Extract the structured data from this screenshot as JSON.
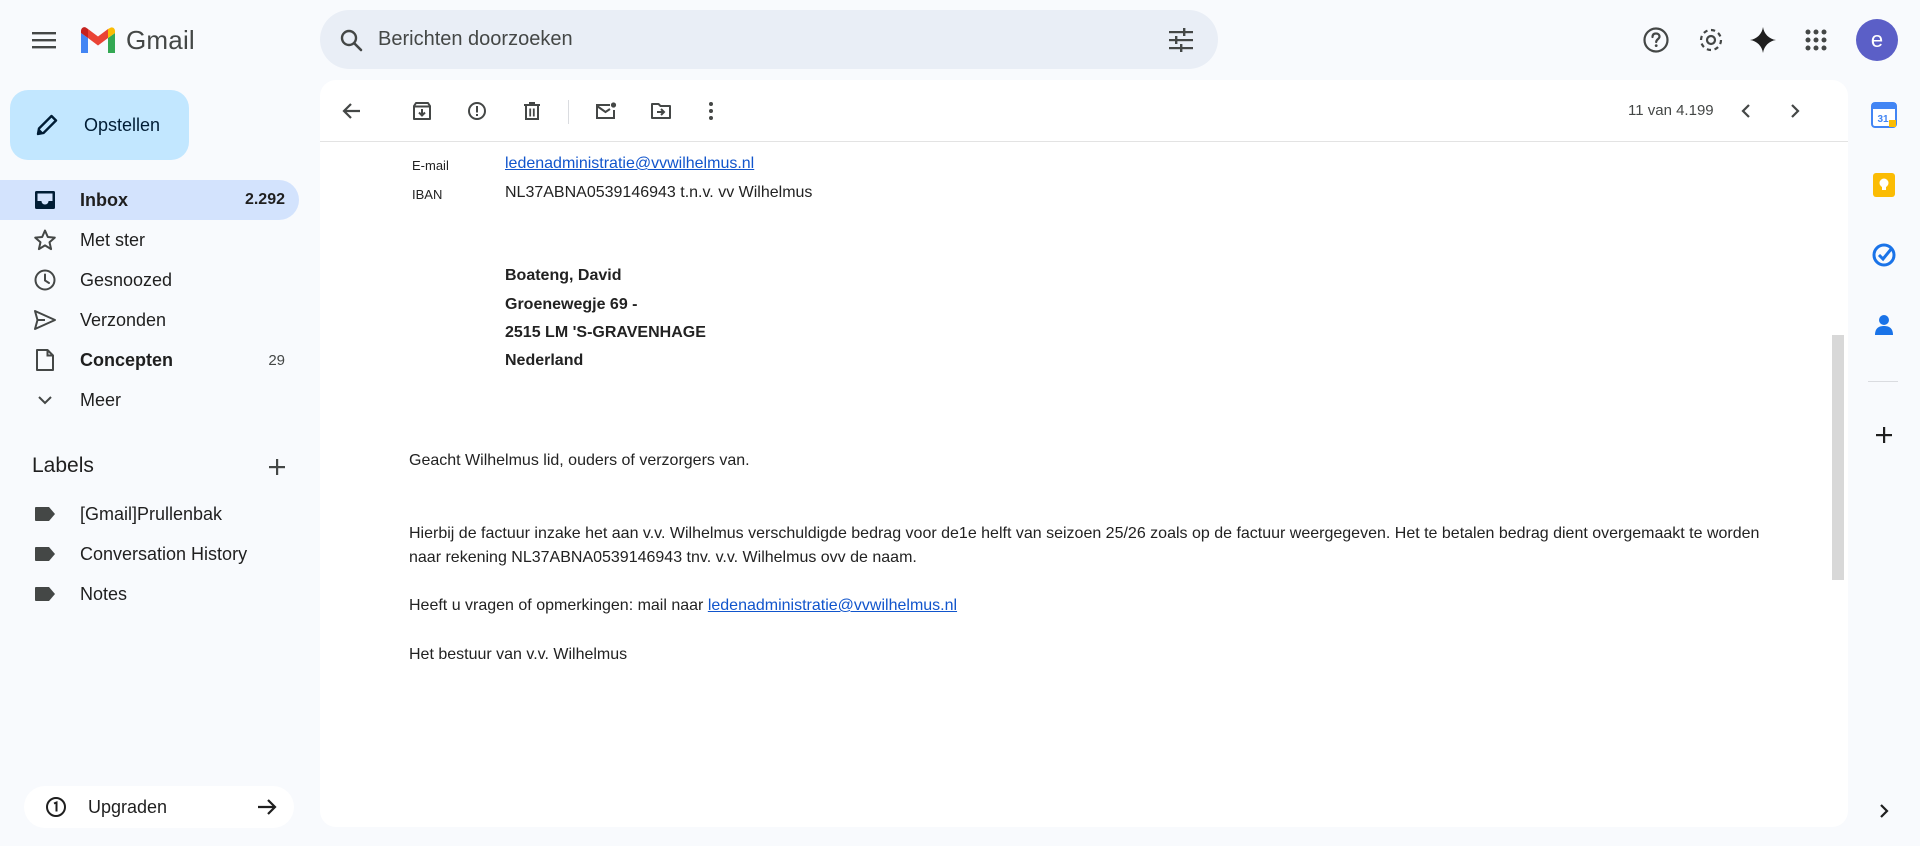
{
  "app": {
    "name": "Gmail",
    "colors": {
      "accent": "#c2e7ff",
      "active_nav": "#d3e3fd",
      "link": "#1155cc",
      "avatar": "#5b5fc7"
    }
  },
  "search": {
    "placeholder": "Berichten doorzoeken"
  },
  "account": {
    "initial": "e"
  },
  "compose": {
    "label": "Opstellen"
  },
  "nav": {
    "items": [
      {
        "label": "Inbox",
        "count": "2.292",
        "icon": "inbox-icon"
      },
      {
        "label": "Met ster",
        "count": "",
        "icon": "star-icon"
      },
      {
        "label": "Gesnoozed",
        "count": "",
        "icon": "clock-icon"
      },
      {
        "label": "Verzonden",
        "count": "",
        "icon": "send-icon"
      },
      {
        "label": "Concepten",
        "count": "29",
        "icon": "draft-icon"
      },
      {
        "label": "Meer",
        "count": "",
        "icon": "chevron-down-icon"
      }
    ]
  },
  "labels": {
    "heading": "Labels",
    "items": [
      {
        "label": "[Gmail]Prullenbak"
      },
      {
        "label": "Conversation History"
      },
      {
        "label": "Notes"
      }
    ]
  },
  "upgrade": {
    "label": "Upgraden"
  },
  "toolbar": {
    "pager": "11 van 4.199"
  },
  "email": {
    "contact": {
      "email_label": "E-mail",
      "email_value": "ledenadministratie@vvwilhelmus.nl",
      "iban_label": "IBAN",
      "iban_value": "NL37ABNA0539146943 t.n.v. vv Wilhelmus"
    },
    "address": [
      "Boateng, David",
      "Groenewegje 69 -",
      "2515 LM 'S-GRAVENHAGE",
      "Nederland"
    ],
    "greeting": "Geacht Wilhelmus lid, ouders of verzorgers van.",
    "body_line1": "Hierbij de factuur inzake het aan v.v. Wilhelmus verschuldigde bedrag voor de1e helft van seizoen 25/26 zoals op de factuur weergegeven. Het te betalen bedrag dient overgemaakt te worden",
    "body_line2": "naar rekening NL37ABNA0539146943 tnv. v.v. Wilhelmus ovv de naam.",
    "questions_prefix": "Heeft u vragen of opmerkingen: mail naar ",
    "questions_link": "ledenadministratie@vvwilhelmus.nl",
    "signature": "Het bestuur van v.v. Wilhelmus"
  },
  "side_panel": {
    "calendar_day": "31"
  }
}
